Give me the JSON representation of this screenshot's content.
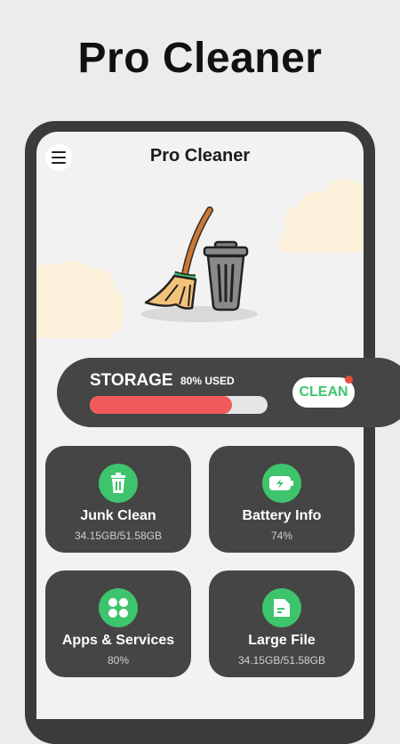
{
  "headline": "Pro Cleaner",
  "app": {
    "title": "Pro Cleaner",
    "menu_icon": "hamburger-menu-icon"
  },
  "storage": {
    "label": "STORAGE",
    "used_text": "80% USED",
    "used_fraction": 0.8,
    "clean_label": "CLEAN"
  },
  "cards": [
    {
      "title": "Junk Clean",
      "subtitle": "34.15GB/51.58GB",
      "icon": "trash-icon"
    },
    {
      "title": "Battery Info",
      "subtitle": "74%",
      "icon": "battery-icon"
    },
    {
      "title": "Apps & Services",
      "subtitle": "80%",
      "icon": "apps-grid-icon"
    },
    {
      "title": "Large File",
      "subtitle": "34.15GB/51.58GB",
      "icon": "folder-icon"
    }
  ],
  "colors": {
    "accent": "#3ec46d",
    "danger": "#f15a5a",
    "card": "#454545",
    "background": "#ececed"
  }
}
